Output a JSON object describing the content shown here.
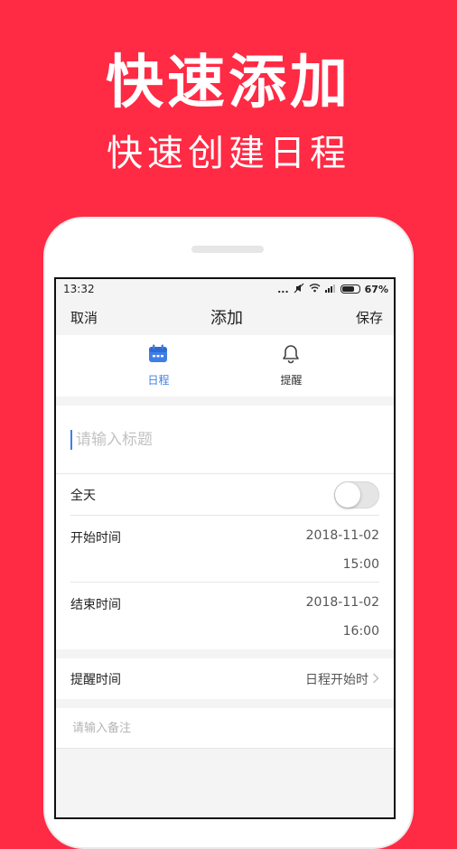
{
  "promo": {
    "title": "快速添加",
    "subtitle": "快速创建日程"
  },
  "statusbar": {
    "time": "13:32",
    "signal_text": "...",
    "battery": "67%"
  },
  "navbar": {
    "cancel_label": "取消",
    "title": "添加",
    "save_label": "保存"
  },
  "tabs": [
    {
      "label": "日程",
      "icon": "calendar-icon",
      "active": true
    },
    {
      "label": "提醒",
      "icon": "bell-icon",
      "active": false
    }
  ],
  "form": {
    "title_placeholder": "请输入标题",
    "title_value": "",
    "allday_label": "全天",
    "allday_on": false,
    "start": {
      "label": "开始时间",
      "date": "2018-11-02",
      "time": "15:00"
    },
    "end": {
      "label": "结束时间",
      "date": "2018-11-02",
      "time": "16:00"
    },
    "reminder": {
      "label": "提醒时间",
      "value": "日程开始时"
    },
    "note_placeholder": "请输入备注"
  },
  "colors": {
    "background": "#ff2a44",
    "accent": "#3f7fe4"
  }
}
